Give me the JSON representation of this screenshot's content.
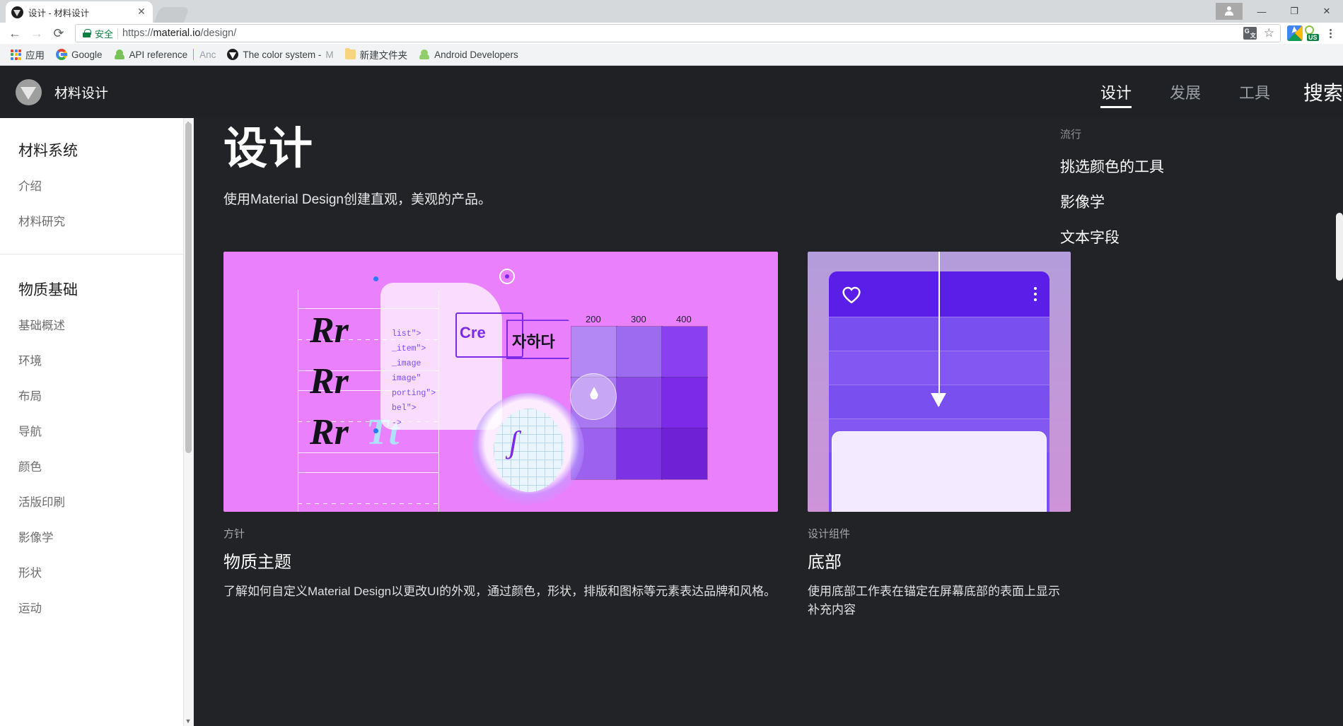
{
  "browser": {
    "tab": {
      "title": "设计 - 材料设计",
      "favicon": "material-icon",
      "close_label": "✕"
    },
    "nav": {
      "back": "←",
      "forward": "→",
      "reload": "⟳"
    },
    "omnibox": {
      "secure_label": "安全",
      "url_scheme": "https://",
      "url_host": "material.io",
      "url_path": "/design/",
      "translate_icon": "translate-icon",
      "bookmark_icon": "star-icon"
    },
    "window": {
      "minimize": "—",
      "maximize": "❐",
      "close": "✕",
      "profile": "profile-icon"
    },
    "extensions": [
      "extension-colorful-icon",
      "extension-us-icon"
    ],
    "menu": "chrome-menu-icon",
    "bookmarks": [
      {
        "label": "应用",
        "icon": "apps-grid-icon",
        "faded": false
      },
      {
        "label": "Google",
        "icon": "google-icon",
        "faded": false
      },
      {
        "label": "API reference",
        "icon": "android-icon",
        "faded": false
      },
      {
        "label": "Anc",
        "icon": "none",
        "faded": true
      },
      {
        "label": "The color system - ",
        "icon": "material-icon",
        "faded": false
      },
      {
        "label": "M",
        "icon": "none",
        "faded": true
      },
      {
        "label": "新建文件夹",
        "icon": "folder-icon",
        "faded": false
      },
      {
        "label": "Android Developers",
        "icon": "android-icon",
        "faded": false
      }
    ]
  },
  "site": {
    "brand": "材料设计",
    "nav": [
      {
        "label": "设计",
        "active": true
      },
      {
        "label": "发展",
        "active": false
      },
      {
        "label": "工具",
        "active": false
      }
    ],
    "search_label": "搜索"
  },
  "sidebar": {
    "groups": [
      {
        "title": "材料系统",
        "items": [
          {
            "label": "介绍"
          },
          {
            "label": "材料研究"
          }
        ]
      },
      {
        "title": "物质基础",
        "items": [
          {
            "label": "基础概述"
          },
          {
            "label": "环境"
          },
          {
            "label": "布局"
          },
          {
            "label": "导航"
          },
          {
            "label": "颜色"
          },
          {
            "label": "活版印刷"
          },
          {
            "label": "影像学"
          },
          {
            "label": "形状"
          },
          {
            "label": "运动"
          }
        ]
      }
    ],
    "scroll_up": "▲",
    "scroll_down": "▼"
  },
  "main": {
    "hero_title": "设计",
    "hero_subtitle": "使用Material Design创建直观，美观的产品。",
    "cards": [
      {
        "eyebrow": "方针",
        "title": "物质主题",
        "desc": "了解如何自定义Material Design以更改UI的外观，通过颜色，形状，排版和图标等元素表达品牌和风格。",
        "thumb": "material-theming-illustration",
        "illustration": {
          "letters": [
            "Rr",
            "Rr",
            "Rr",
            "Tt"
          ],
          "code_lines": [
            "list\">",
            "_item\">",
            "_image",
            "image\"",
            "porting\">",
            "bel\">",
            "->"
          ],
          "create_word": "Cre",
          "korean_word": "자하다",
          "swatch_numbers": [
            "200",
            "300",
            "400"
          ],
          "swatch_colors": [
            "#b388f5",
            "#9d6bf0",
            "#8a3ff0",
            "#a977f2",
            "#8b4ae8",
            "#7c2ae8",
            "#9c62ef",
            "#7d33e3",
            "#6f21d6"
          ]
        }
      },
      {
        "eyebrow": "设计组件",
        "title": "底部",
        "desc": "使用底部工作表在锚定在屏幕底部的表面上显示补充内容",
        "thumb": "bottom-sheet-illustration"
      }
    ],
    "right_column": {
      "eyebrow": "流行",
      "links": [
        {
          "label": "挑选颜色的工具"
        },
        {
          "label": "影像学"
        },
        {
          "label": "文本字段"
        }
      ]
    }
  }
}
